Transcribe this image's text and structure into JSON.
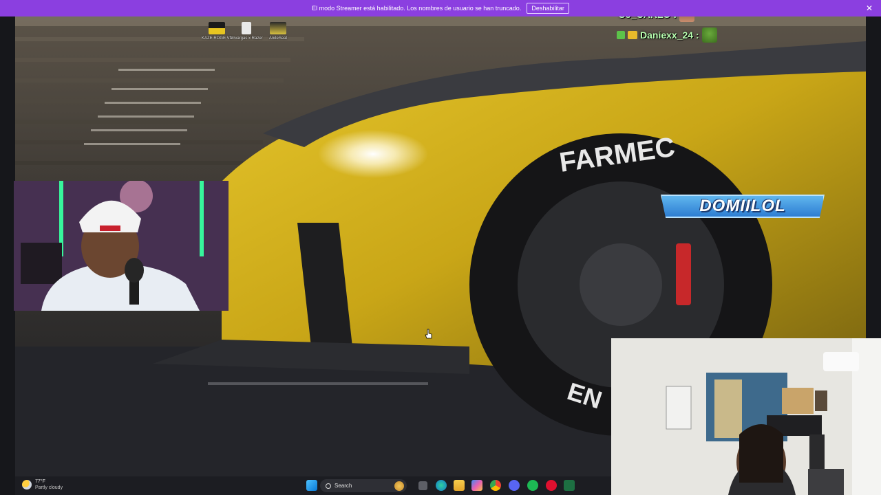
{
  "banner": {
    "message": "El modo Streamer está habilitado. Los nombres de usuario se han truncado.",
    "disable_label": "Deshabilitar",
    "close_glyph": "✕",
    "color": "#8b3fe0"
  },
  "desktop_icons": [
    {
      "label": "KAZE ROGE V3",
      "icon": "file-thumbnail-icon"
    },
    {
      "label": "Mrvargas x Razer",
      "icon": "image-thumbnail-icon"
    },
    {
      "label": "AndeSeat",
      "icon": "car-thumbnail-icon"
    }
  ],
  "chat": [
    {
      "name": "So_CARLO :",
      "icon": "avatar-icon"
    },
    {
      "name": "Daniexx_24 :",
      "icon": "pepe-emote-icon"
    }
  ],
  "nameplate": {
    "text": "DOMIILOL"
  },
  "scene": {
    "brand_text": "FARMEC",
    "bottom_text": "EN",
    "car_color": "#d9b71e"
  },
  "taskbar": {
    "weather_temp": "77°F",
    "weather_condition": "Partly cloudy",
    "search_placeholder": "Search",
    "apps": [
      "windows-start-icon",
      "task-view-icon",
      "edge-icon",
      "file-explorer-icon",
      "copilot-icon",
      "chrome-icon",
      "discord-icon",
      "spotify-icon",
      "opera-icon",
      "excel-icon"
    ]
  }
}
